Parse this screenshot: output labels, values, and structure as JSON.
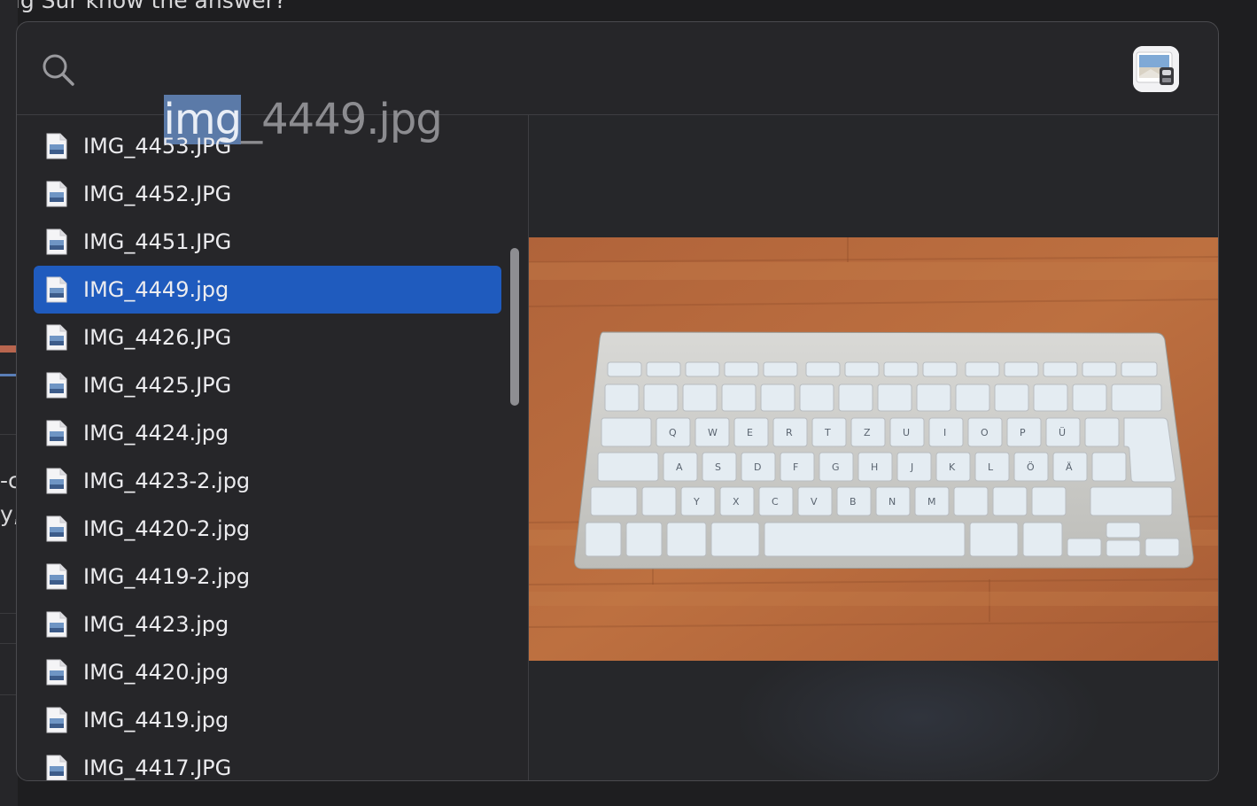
{
  "background": {
    "heading_fragment": "big Sur know the answer?",
    "left_fragments": [
      "-c",
      "y,"
    ]
  },
  "search": {
    "query_selected": "img",
    "query_rest": "_4449.jpg"
  },
  "results": [
    {
      "label": "IMG_4453.JPG"
    },
    {
      "label": "IMG_4452.JPG"
    },
    {
      "label": "IMG_4451.JPG"
    },
    {
      "label": "IMG_4449.jpg",
      "selected": true
    },
    {
      "label": "IMG_4426.JPG"
    },
    {
      "label": "IMG_4425.JPG"
    },
    {
      "label": "IMG_4424.jpg"
    },
    {
      "label": "IMG_4423-2.jpg"
    },
    {
      "label": "IMG_4420-2.jpg"
    },
    {
      "label": "IMG_4419-2.jpg"
    },
    {
      "label": "IMG_4423.jpg"
    },
    {
      "label": "IMG_4420.jpg"
    },
    {
      "label": "IMG_4419.jpg"
    },
    {
      "label": "IMG_4417.JPG"
    }
  ],
  "colors": {
    "selection": "#1f5bbe",
    "query_highlight": "#5b7aa8",
    "panel": "#262629",
    "wood": "#b8693a"
  },
  "icons": {
    "search": "magnifying-glass-icon",
    "app": "preview-app-icon",
    "file": "jpeg-document-icon"
  }
}
